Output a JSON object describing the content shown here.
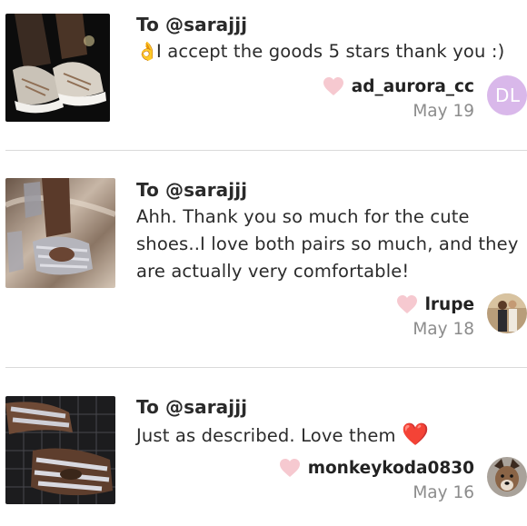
{
  "reviews": [
    {
      "to": "To @sarajjj",
      "emoji": "👌",
      "message": "I accept the goods 5 stars thank you :)",
      "username": "ad_aurora_cc",
      "date": "May 19",
      "avatar_initials": "DL",
      "avatar_color": "#d9b8ea",
      "thumbnail": "clear strappy platform sneaker photo"
    },
    {
      "to": "To @sarajjj",
      "message": "Ahh. Thank you so much for the cute shoes..I love both pairs so much, and they are actually very comfortable!",
      "username": "lrupe",
      "date": "May 18",
      "thumbnail": "glitter slide sandal on satin photo"
    },
    {
      "to": "To @sarajjj",
      "message": "Just as described. Love them",
      "message_emoji": "❤️",
      "username": "monkeykoda0830",
      "date": "May 16",
      "thumbnail": "rhinestone strap sandal photo"
    }
  ],
  "colors": {
    "like_heart": "#f6c9d0",
    "divider": "#dadada",
    "date_text": "#8c8c8c",
    "red_heart": "#e5162c"
  },
  "icons": {
    "like": "heart-icon"
  }
}
